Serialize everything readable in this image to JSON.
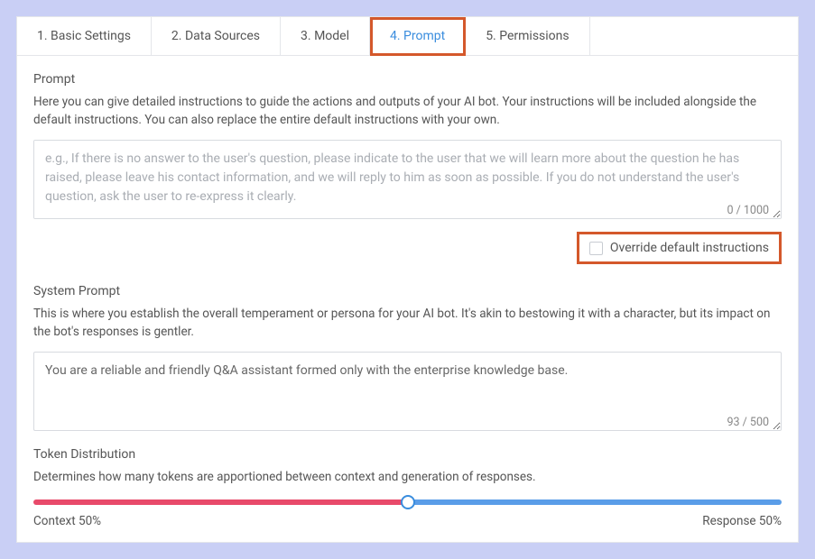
{
  "tabs": [
    {
      "label": "1. Basic Settings",
      "active": false
    },
    {
      "label": "2. Data Sources",
      "active": false
    },
    {
      "label": "3. Model",
      "active": false
    },
    {
      "label": "4. Prompt",
      "active": true
    },
    {
      "label": "5. Permissions",
      "active": false
    }
  ],
  "prompt": {
    "title": "Prompt",
    "description": "Here you can give detailed instructions to guide the actions and outputs of your AI bot. Your instructions will be included alongside the default instructions. You can also replace the entire default instructions with your own.",
    "placeholder": "e.g., If there is no answer to the user's question, please indicate to the user that we will learn more about the question he has raised, please leave his contact information, and we will reply to him as soon as possible. If you do not understand the user's question, ask the user to re-express it clearly.",
    "value": "",
    "count": "0 / 1000"
  },
  "override": {
    "label": "Override default instructions",
    "checked": false
  },
  "system_prompt": {
    "title": "System Prompt",
    "description": "This is where you establish the overall temperament or persona for your AI bot. It's akin to bestowing it with a character, but its impact on the bot's responses is gentler.",
    "value": "You are a reliable and friendly Q&A assistant formed only with the enterprise knowledge base.",
    "count": "93 / 500"
  },
  "token_dist": {
    "title": "Token Distribution",
    "description": "Determines how many tokens are apportioned between context and generation of responses.",
    "context_label": "Context 50%",
    "response_label": "Response 50%",
    "percent": 50
  }
}
